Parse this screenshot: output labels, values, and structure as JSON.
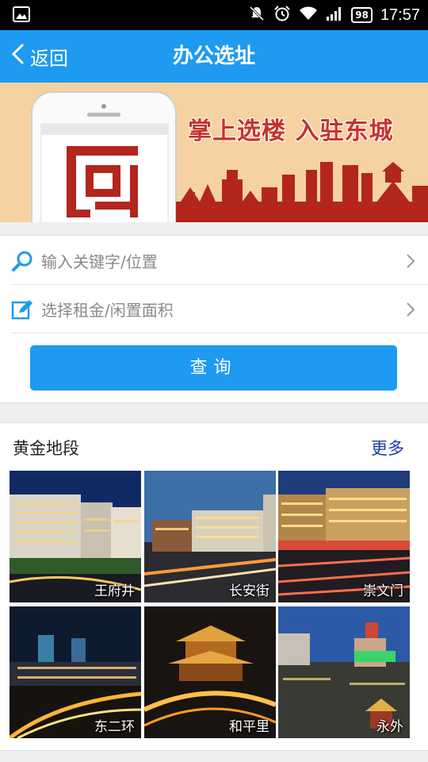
{
  "status_bar": {
    "time": "17:57",
    "battery": "98"
  },
  "header": {
    "back_label": "返回",
    "title": "办公选址"
  },
  "banner": {
    "slogan": "掌上选楼  入驻东城"
  },
  "search": {
    "keyword_placeholder": "输入关键字/位置",
    "filter_placeholder": "选择租金/闲置面积",
    "query_label": "查询"
  },
  "golden": {
    "title": "黄金地段",
    "more_label": "更多",
    "tiles": [
      {
        "label": "王府井"
      },
      {
        "label": "长安街"
      },
      {
        "label": "崇文门"
      },
      {
        "label": "东二环"
      },
      {
        "label": "和平里"
      },
      {
        "label": "永外"
      }
    ]
  },
  "colors": {
    "primary": "#1e9af0",
    "more_link": "#1a3da8",
    "banner_bg": "#f6d2a2",
    "banner_red": "#b3261e"
  },
  "icons": [
    "image-icon",
    "mute-icon",
    "alarm-icon",
    "wifi-icon",
    "signal-icon",
    "battery-icon",
    "back-chevron-icon",
    "search-icon",
    "edit-icon",
    "chevron-right-icon"
  ]
}
